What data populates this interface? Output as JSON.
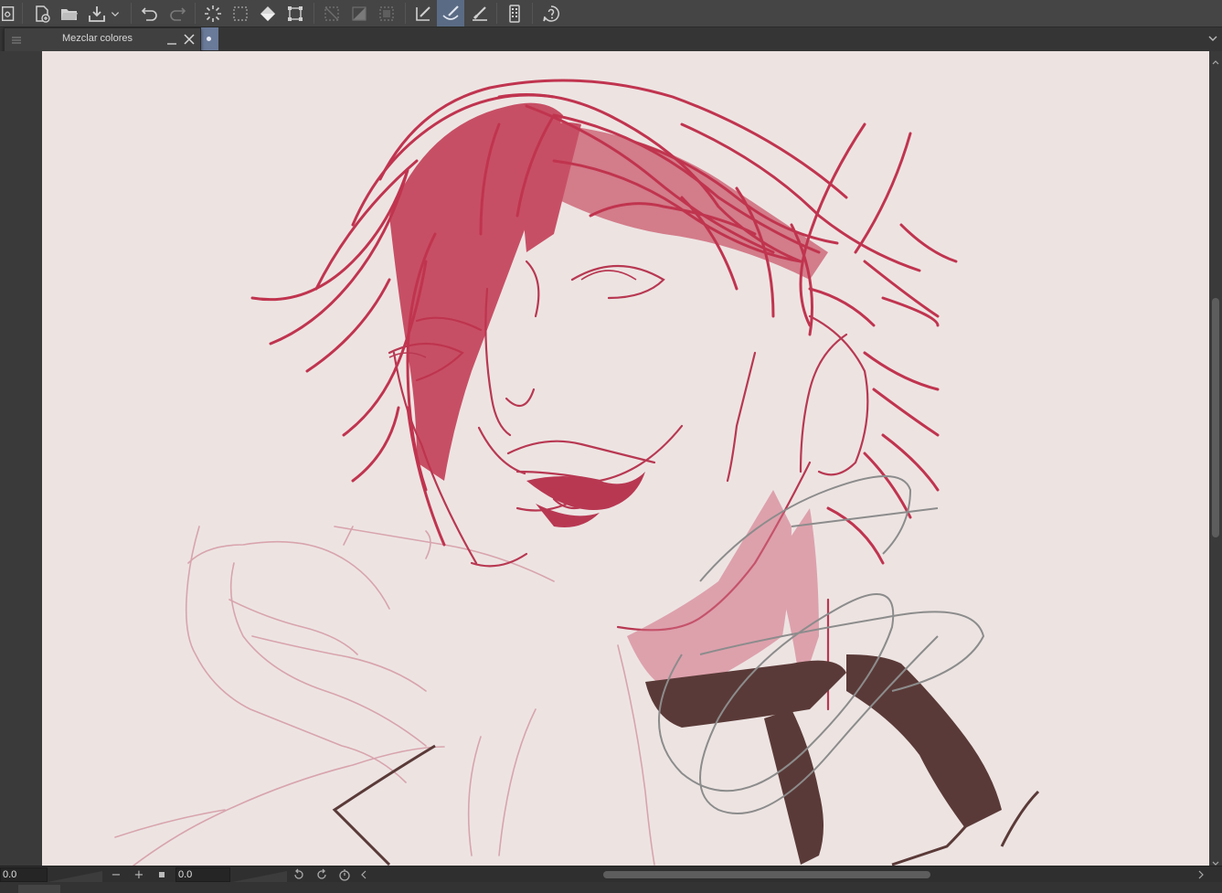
{
  "toolbar": {
    "buttons": [
      {
        "name": "app-menu-icon"
      },
      {
        "name": "new-document-icon"
      },
      {
        "name": "open-document-icon"
      },
      {
        "name": "save-document-icon"
      },
      {
        "name": "save-dropdown-icon"
      },
      {
        "name": "undo-icon"
      },
      {
        "name": "redo-icon"
      },
      {
        "name": "select-all-icon"
      },
      {
        "name": "deselect-icon"
      },
      {
        "name": "fill-icon"
      },
      {
        "name": "transform-icon"
      },
      {
        "name": "hide-selection-icon"
      },
      {
        "name": "gradient-icon"
      },
      {
        "name": "clipping-icon"
      },
      {
        "name": "edit-brush-icon"
      },
      {
        "name": "brush-presets-icon"
      },
      {
        "name": "eraser-mode-icon"
      },
      {
        "name": "phone-layout-icon"
      },
      {
        "name": "help-icon"
      }
    ]
  },
  "docker": {
    "title": "Mezclar colores"
  },
  "bottom": {
    "field1": "0.0",
    "field2": "0.0",
    "minus": "−",
    "plus": "+"
  },
  "colors": {
    "hair": "#c0344f",
    "lines": "#b83852",
    "light": "#d8a4ad",
    "dark": "#5a3a38",
    "gray": "#8c8c8c",
    "canvas": "#ede4e2",
    "accent": "#5a6b85"
  }
}
